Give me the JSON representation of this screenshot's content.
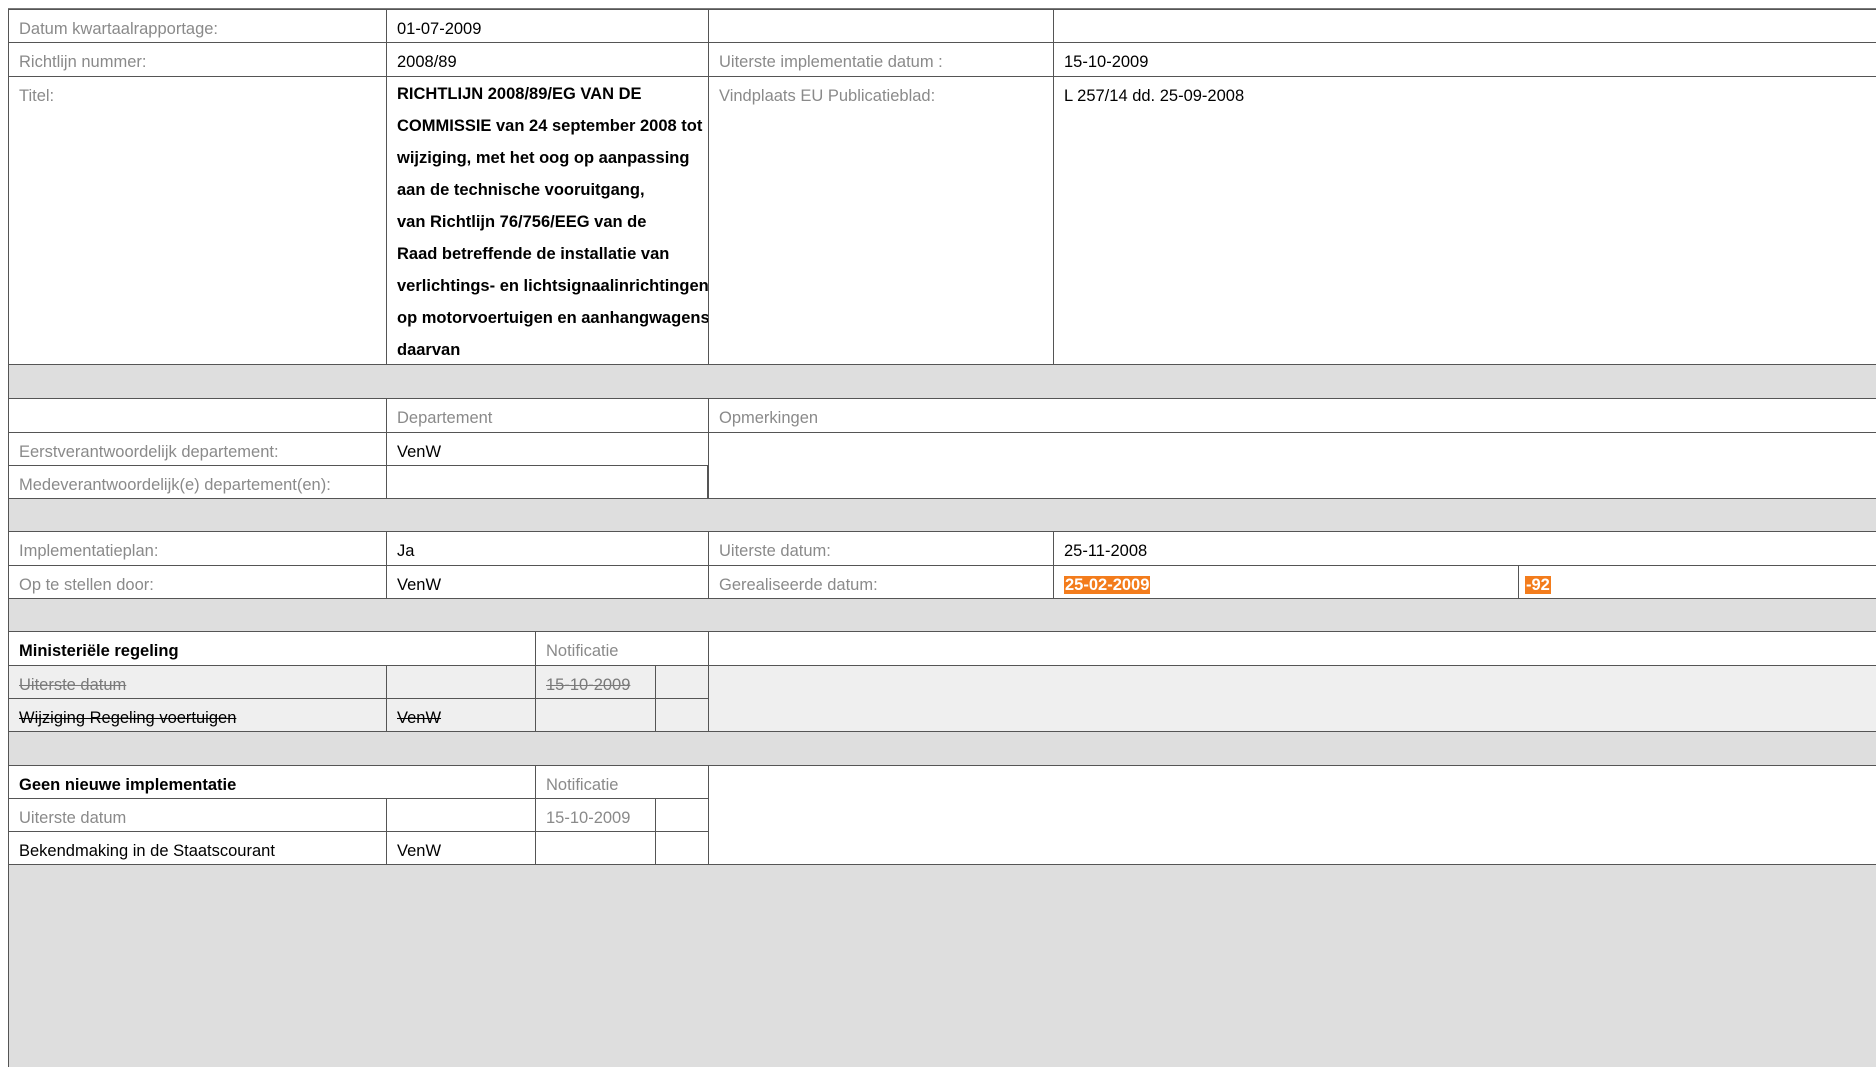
{
  "datum_label": "Datum kwartaalrapportage:",
  "datum_value": "01-07-2009",
  "richtlijn_label": "Richtlijn nummer:",
  "richtlijn_value": "2008/89",
  "uiterste_impl_label": "Uiterste implementatie datum :",
  "uiterste_impl_value": "15-10-2009",
  "titel_label": "Titel:",
  "titel_lines": [
    "RICHTLIJN 2008/89/EG VAN DE",
    "COMMISSIE van 24 september 2008 tot",
    "wijziging, met het oog op aanpassing",
    "aan de technische vooruitgang,",
    "van Richtlijn 76/756/EEG van de",
    "Raad betreffende de installatie van",
    "verlichtings- en lichtsignaalinrichtingen",
    "op motorvoertuigen en aanhangwagens",
    "daarvan"
  ],
  "vindplaats_label": "Vindplaats EU Publicatieblad:",
  "vindplaats_value": "L 257/14 dd. 25-09-2008",
  "departement_header": "Departement",
  "opmerkingen_header": "Opmerkingen",
  "eerstverantw_label": "Eerstverantwoordelijk departement:",
  "eerstverantw_value": "VenW",
  "medeverantw_label": "Medeverantwoordelijk(e) departement(en):",
  "medeverantw_value": "",
  "implplan_label": "Implementatieplan:",
  "implplan_value": "Ja",
  "uiterste_datum_label": "Uiterste datum:",
  "uiterste_datum_value": "25-11-2008",
  "optestellen_label": "Op te stellen door:",
  "optestellen_value": "VenW",
  "gerealiseerd_label": "Gerealiseerde datum:",
  "gerealiseerd_value": "25-02-2009",
  "gerealiseerd_diff": "-92",
  "colors": {
    "accent_orange": "#f37c1c",
    "band_gray": "#dedede",
    "label_gray": "#8a8a8a"
  },
  "ministeriele": {
    "heading": "Ministeriële regeling",
    "notificatie": "Notificatie",
    "row1_label": "Uiterste datum",
    "row1_date": "15-10-2009",
    "row2_label": "Wijziging Regeling voertuigen",
    "row2_dept": "VenW"
  },
  "geen_nieuwe": {
    "heading": "Geen nieuwe implementatie",
    "notificatie": "Notificatie",
    "row1_label": "Uiterste datum",
    "row1_date": "15-10-2009",
    "row2_label": "Bekendmaking in de Staatscourant",
    "row2_dept": "VenW"
  }
}
